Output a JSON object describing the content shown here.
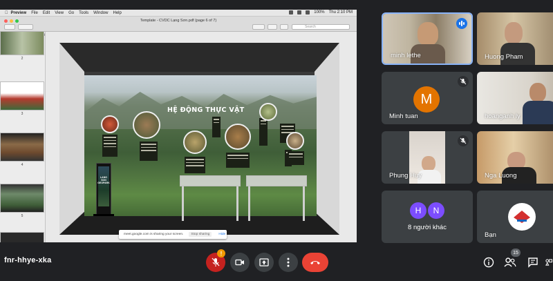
{
  "shared_screen": {
    "menubar": {
      "app": "Preview",
      "items": [
        "File",
        "Edit",
        "View",
        "Go",
        "Tools",
        "Window",
        "Help"
      ],
      "battery": "100%",
      "clock": "Thu 2:10 PM"
    },
    "document_title": "Template - CVDC Lạng Sơn.pdf (page 6 of 7)",
    "search_placeholder": "Search",
    "sidebar_title": "Template - CVDC Lang Son.pdf",
    "page_numbers": [
      "2",
      "3",
      "4",
      "5",
      "6"
    ],
    "selected_page": "6",
    "mural_title": "HỆ ĐỘNG THỰC VẬT",
    "kiosk_text": "LANG SON GEOPARK",
    "share_notice": {
      "message": "meet.google.com is sharing your screen.",
      "stop_label": "Stop sharing",
      "hide_label": "Hide"
    }
  },
  "participants": [
    {
      "name": "minh lethe",
      "state": "speaking"
    },
    {
      "name": "Huong Pham",
      "state": "video"
    },
    {
      "name": "Minh tuan",
      "state": "muted",
      "initial": "M",
      "avatar_color": "#e37400"
    },
    {
      "name": "hoanganh ly",
      "state": "video"
    },
    {
      "name": "Phung Huy",
      "state": "muted"
    },
    {
      "name": "Nga Luong",
      "state": "video"
    },
    {
      "name": "8 người khác",
      "initials": [
        "H",
        "N"
      ],
      "avatar_color": "#7c4dff"
    },
    {
      "name": "Bạn",
      "state": "self"
    }
  ],
  "bottom_bar": {
    "meeting_code": "fnr-hhye-xka",
    "warning_badge": "!",
    "people_count": "15",
    "controls": [
      "mic-off",
      "camera",
      "present",
      "more",
      "leave-call"
    ],
    "right_icons": [
      "info",
      "people",
      "chat",
      "activities"
    ]
  },
  "colors": {
    "background": "#202124",
    "tile": "#3c4043",
    "accent": "#8ab4f8",
    "leave": "#ea4335",
    "warning": "#f29900"
  }
}
